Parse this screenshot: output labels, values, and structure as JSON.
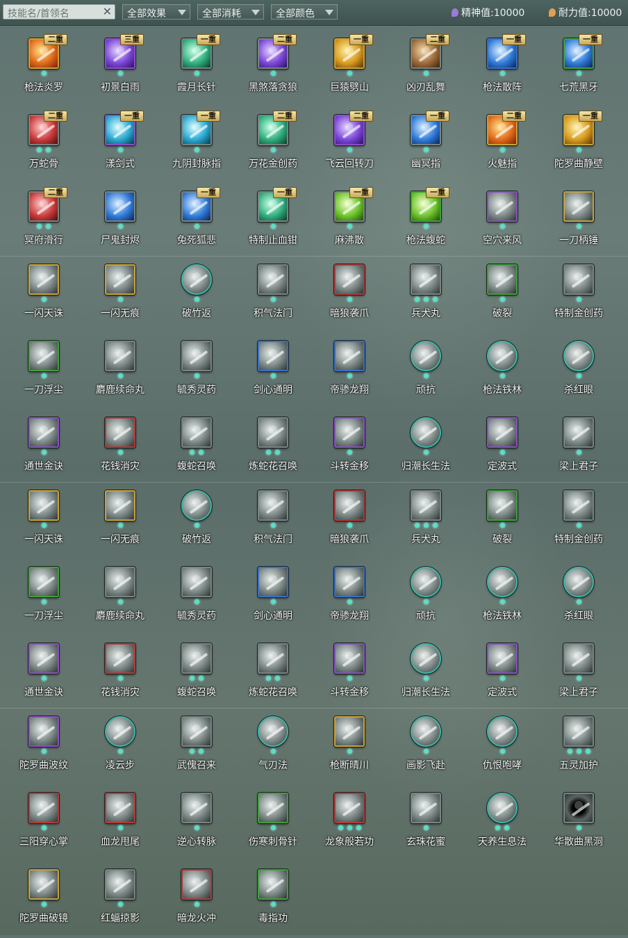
{
  "toolbar": {
    "search_placeholder": "技能名/首领名",
    "filter_effect": "全部效果",
    "filter_cost": "全部消耗",
    "filter_color": "全部颜色",
    "spirit_label": "精神值:10000",
    "endurance_label": "耐力值:10000"
  },
  "colors": {
    "gold_frame": "#c9a23a",
    "purple_frame": "#8c4fc4",
    "blue_frame": "#3a6fc4",
    "green_frame": "#3fa03a",
    "red_frame": "#b43a3a",
    "gray_frame": "#7a8482",
    "teal_frame": "#3bb8a8",
    "dot": "#58e0c6"
  },
  "skills": [
    {
      "name": "枪法炎罗",
      "tier": "二重",
      "frame": "gold",
      "art": "fire",
      "dots": 1
    },
    {
      "name": "初景白雨",
      "tier": "三重",
      "frame": "purple",
      "art": "violet",
      "dots": 1
    },
    {
      "name": "霞月长针",
      "tier": "一重",
      "frame": "gray",
      "art": "green",
      "dots": 1
    },
    {
      "name": "黑煞落贪狼",
      "tier": "二重",
      "frame": "gray",
      "art": "violet",
      "dots": 1
    },
    {
      "name": "巨猿劈山",
      "tier": "一重",
      "frame": "gold",
      "art": "gold",
      "dots": 1
    },
    {
      "name": "凶刃乱舞",
      "tier": "二重",
      "frame": "gray",
      "art": "brown",
      "dots": 1
    },
    {
      "name": "枪法散阵",
      "tier": "一重",
      "frame": "blue",
      "art": "blue",
      "dots": 1
    },
    {
      "name": "七荒黑牙",
      "tier": "一重",
      "frame": "green",
      "art": "blue",
      "dots": 1
    },
    {
      "name": "万蛇骨",
      "tier": "二重",
      "frame": "gray",
      "art": "red",
      "dots": 2
    },
    {
      "name": "漾剑式",
      "tier": "一重",
      "frame": "purple",
      "art": "cyan",
      "dots": 1
    },
    {
      "name": "九阴封脉指",
      "tier": "一重",
      "frame": "gray",
      "art": "cyan",
      "dots": 1
    },
    {
      "name": "万花金创药",
      "tier": "二重",
      "frame": "gray",
      "art": "green",
      "dots": 1
    },
    {
      "name": "飞云回转刀",
      "tier": "二重",
      "frame": "purple",
      "art": "violet",
      "dots": 1
    },
    {
      "name": "幽冥指",
      "tier": "一重",
      "frame": "gray",
      "art": "blue",
      "dots": 1
    },
    {
      "name": "火魅指",
      "tier": "二重",
      "frame": "gold",
      "art": "fire",
      "dots": 1
    },
    {
      "name": "陀罗曲静壁",
      "tier": "一重",
      "frame": "gold",
      "art": "gold",
      "dots": 1
    },
    {
      "name": "冥府滑行",
      "tier": "二重",
      "frame": "gray",
      "art": "red",
      "dots": 2
    },
    {
      "name": "尸鬼封烬",
      "tier": "",
      "frame": "gray",
      "art": "blue",
      "dots": 1
    },
    {
      "name": "兔死狐悲",
      "tier": "一重",
      "frame": "gray",
      "art": "blue",
      "dots": 1
    },
    {
      "name": "特制止血钳",
      "tier": "一重",
      "frame": "gray",
      "art": "green",
      "dots": 1
    },
    {
      "name": "麻沸散",
      "tier": "一重",
      "frame": "gray",
      "art": "lime",
      "dots": 1
    },
    {
      "name": "枪法蝮蛇",
      "tier": "一重",
      "frame": "green",
      "art": "lime",
      "dots": 1
    },
    {
      "name": "空穴来风",
      "tier": "",
      "frame": "purple",
      "art": "gray",
      "dots": 1
    },
    {
      "name": "一刀柄锤",
      "tier": "",
      "frame": "gold",
      "art": "gray",
      "dots": 1
    },
    {
      "name": "一闪天诛",
      "tier": "",
      "frame": "gold",
      "art": "gray",
      "dots": 1
    },
    {
      "name": "一闪无痕",
      "tier": "",
      "frame": "gold",
      "art": "gray",
      "dots": 1
    },
    {
      "name": "破竹返",
      "tier": "",
      "frame": "teal",
      "art": "gray",
      "round": true,
      "dots": 1
    },
    {
      "name": "积气法门",
      "tier": "",
      "frame": "gray",
      "art": "gray",
      "dots": 1
    },
    {
      "name": "暗狼袭爪",
      "tier": "",
      "frame": "red",
      "art": "gray",
      "dots": 1
    },
    {
      "name": "兵犬丸",
      "tier": "",
      "frame": "gray",
      "art": "gray",
      "dots": 3
    },
    {
      "name": "破裂",
      "tier": "",
      "frame": "green",
      "art": "gray",
      "dots": 1
    },
    {
      "name": "特制金创药",
      "tier": "",
      "frame": "gray",
      "art": "gray",
      "dots": 1
    },
    {
      "name": "一刀浮尘",
      "tier": "",
      "frame": "green",
      "art": "gray",
      "dots": 1
    },
    {
      "name": "麝鹿续命丸",
      "tier": "",
      "frame": "gray",
      "art": "gray",
      "dots": 1
    },
    {
      "name": "毓秀灵药",
      "tier": "",
      "frame": "gray",
      "art": "gray",
      "dots": 1
    },
    {
      "name": "剑心通明",
      "tier": "",
      "frame": "blue",
      "art": "gray",
      "dots": 1
    },
    {
      "name": "帝骖龙翔",
      "tier": "",
      "frame": "blue",
      "art": "gray",
      "dots": 1
    },
    {
      "name": "顽抗",
      "tier": "",
      "frame": "teal",
      "art": "gray",
      "round": true,
      "dots": 1
    },
    {
      "name": "枪法铁林",
      "tier": "",
      "frame": "teal",
      "art": "gray",
      "round": true,
      "dots": 1
    },
    {
      "name": "杀红眼",
      "tier": "",
      "frame": "teal",
      "art": "gray",
      "round": true,
      "dots": 1
    },
    {
      "name": "通世金诀",
      "tier": "",
      "frame": "purple",
      "art": "gray",
      "dots": 1
    },
    {
      "name": "花钱消灾",
      "tier": "",
      "frame": "red",
      "art": "gray",
      "dots": 1
    },
    {
      "name": "蝮蛇召唤",
      "tier": "",
      "frame": "gray",
      "art": "gray",
      "dots": 2
    },
    {
      "name": "炼蛇花召唤",
      "tier": "",
      "frame": "gray",
      "art": "gray",
      "dots": 2
    },
    {
      "name": "斗转金移",
      "tier": "",
      "frame": "purple",
      "art": "gray",
      "dots": 1
    },
    {
      "name": "归潮长生法",
      "tier": "",
      "frame": "teal",
      "art": "gray",
      "round": true,
      "dots": 1
    },
    {
      "name": "定波式",
      "tier": "",
      "frame": "purple",
      "art": "gray",
      "dots": 1
    },
    {
      "name": "梁上君子",
      "tier": "",
      "frame": "gray",
      "art": "gray",
      "dots": 1
    },
    {
      "name": "一闪天诛",
      "tier": "",
      "frame": "gold",
      "art": "gray",
      "dots": 1
    },
    {
      "name": "一闪无痕",
      "tier": "",
      "frame": "gold",
      "art": "gray",
      "dots": 1
    },
    {
      "name": "破竹返",
      "tier": "",
      "frame": "teal",
      "art": "gray",
      "round": true,
      "dots": 1
    },
    {
      "name": "积气法门",
      "tier": "",
      "frame": "gray",
      "art": "gray",
      "dots": 1
    },
    {
      "name": "暗狼袭爪",
      "tier": "",
      "frame": "red",
      "art": "gray",
      "dots": 1
    },
    {
      "name": "兵犬丸",
      "tier": "",
      "frame": "gray",
      "art": "gray",
      "dots": 3
    },
    {
      "name": "破裂",
      "tier": "",
      "frame": "green",
      "art": "gray",
      "dots": 1
    },
    {
      "name": "特制金创药",
      "tier": "",
      "frame": "gray",
      "art": "gray",
      "dots": 1
    },
    {
      "name": "一刀浮尘",
      "tier": "",
      "frame": "green",
      "art": "gray",
      "dots": 1
    },
    {
      "name": "麝鹿续命丸",
      "tier": "",
      "frame": "gray",
      "art": "gray",
      "dots": 1
    },
    {
      "name": "毓秀灵药",
      "tier": "",
      "frame": "gray",
      "art": "gray",
      "dots": 1
    },
    {
      "name": "剑心通明",
      "tier": "",
      "frame": "blue",
      "art": "gray",
      "dots": 1
    },
    {
      "name": "帝骖龙翔",
      "tier": "",
      "frame": "blue",
      "art": "gray",
      "dots": 1
    },
    {
      "name": "顽抗",
      "tier": "",
      "frame": "teal",
      "art": "gray",
      "round": true,
      "dots": 1
    },
    {
      "name": "枪法铁林",
      "tier": "",
      "frame": "teal",
      "art": "gray",
      "round": true,
      "dots": 1
    },
    {
      "name": "杀红眼",
      "tier": "",
      "frame": "teal",
      "art": "gray",
      "round": true,
      "dots": 1
    },
    {
      "name": "通世金诀",
      "tier": "",
      "frame": "purple",
      "art": "gray",
      "dots": 1
    },
    {
      "name": "花钱消灾",
      "tier": "",
      "frame": "red",
      "art": "gray",
      "dots": 1
    },
    {
      "name": "蝮蛇召唤",
      "tier": "",
      "frame": "gray",
      "art": "gray",
      "dots": 2
    },
    {
      "name": "炼蛇花召唤",
      "tier": "",
      "frame": "gray",
      "art": "gray",
      "dots": 2
    },
    {
      "name": "斗转金移",
      "tier": "",
      "frame": "purple",
      "art": "gray",
      "dots": 1
    },
    {
      "name": "归潮长生法",
      "tier": "",
      "frame": "teal",
      "art": "gray",
      "round": true,
      "dots": 1
    },
    {
      "name": "定波式",
      "tier": "",
      "frame": "purple",
      "art": "gray",
      "dots": 1
    },
    {
      "name": "梁上君子",
      "tier": "",
      "frame": "gray",
      "art": "gray",
      "dots": 1
    },
    {
      "name": "陀罗曲波纹",
      "tier": "",
      "frame": "purple",
      "art": "gray",
      "dots": 1
    },
    {
      "name": "凌云步",
      "tier": "",
      "frame": "teal",
      "art": "gray",
      "round": true,
      "dots": 1
    },
    {
      "name": "武傀召来",
      "tier": "",
      "frame": "gray",
      "art": "gray",
      "dots": 2
    },
    {
      "name": "气刃法",
      "tier": "",
      "frame": "teal",
      "art": "gray",
      "round": true,
      "dots": 1
    },
    {
      "name": "枪断晴川",
      "tier": "",
      "frame": "gold",
      "art": "gray",
      "dots": 1
    },
    {
      "name": "画影飞赴",
      "tier": "",
      "frame": "teal",
      "art": "gray",
      "round": true,
      "dots": 1
    },
    {
      "name": "仇恨咆哮",
      "tier": "",
      "frame": "teal",
      "art": "gray",
      "round": true,
      "dots": 1
    },
    {
      "name": "五灵加护",
      "tier": "",
      "frame": "gray",
      "art": "gray",
      "dots": 3
    },
    {
      "name": "三阳穿心掌",
      "tier": "",
      "frame": "red",
      "art": "gray",
      "dots": 1
    },
    {
      "name": "血龙甩尾",
      "tier": "",
      "frame": "red",
      "art": "gray",
      "dots": 1
    },
    {
      "name": "逆心转脉",
      "tier": "",
      "frame": "gray",
      "art": "gray",
      "dots": 1
    },
    {
      "name": "伤寒刺骨针",
      "tier": "",
      "frame": "green",
      "art": "gray",
      "dots": 1
    },
    {
      "name": "龙象般若功",
      "tier": "",
      "frame": "red",
      "art": "gray",
      "dots": 3
    },
    {
      "name": "玄珠花蜜",
      "tier": "",
      "frame": "gray",
      "art": "gray",
      "dots": 1
    },
    {
      "name": "天养生息法",
      "tier": "",
      "frame": "teal",
      "art": "gray",
      "round": true,
      "dots": 2
    },
    {
      "name": "华散曲黑洞",
      "tier": "",
      "frame": "gray",
      "art": "dark",
      "dots": 1
    },
    {
      "name": "陀罗曲破镜",
      "tier": "",
      "frame": "gold",
      "art": "gray",
      "dots": 1
    },
    {
      "name": "红蝠掠影",
      "tier": "",
      "frame": "gray",
      "art": "gray",
      "dots": 1
    },
    {
      "name": "暗龙火冲",
      "tier": "",
      "frame": "red",
      "art": "gray",
      "dots": 1
    },
    {
      "name": "毒指功",
      "tier": "",
      "frame": "green",
      "art": "gray",
      "dots": 1
    }
  ]
}
